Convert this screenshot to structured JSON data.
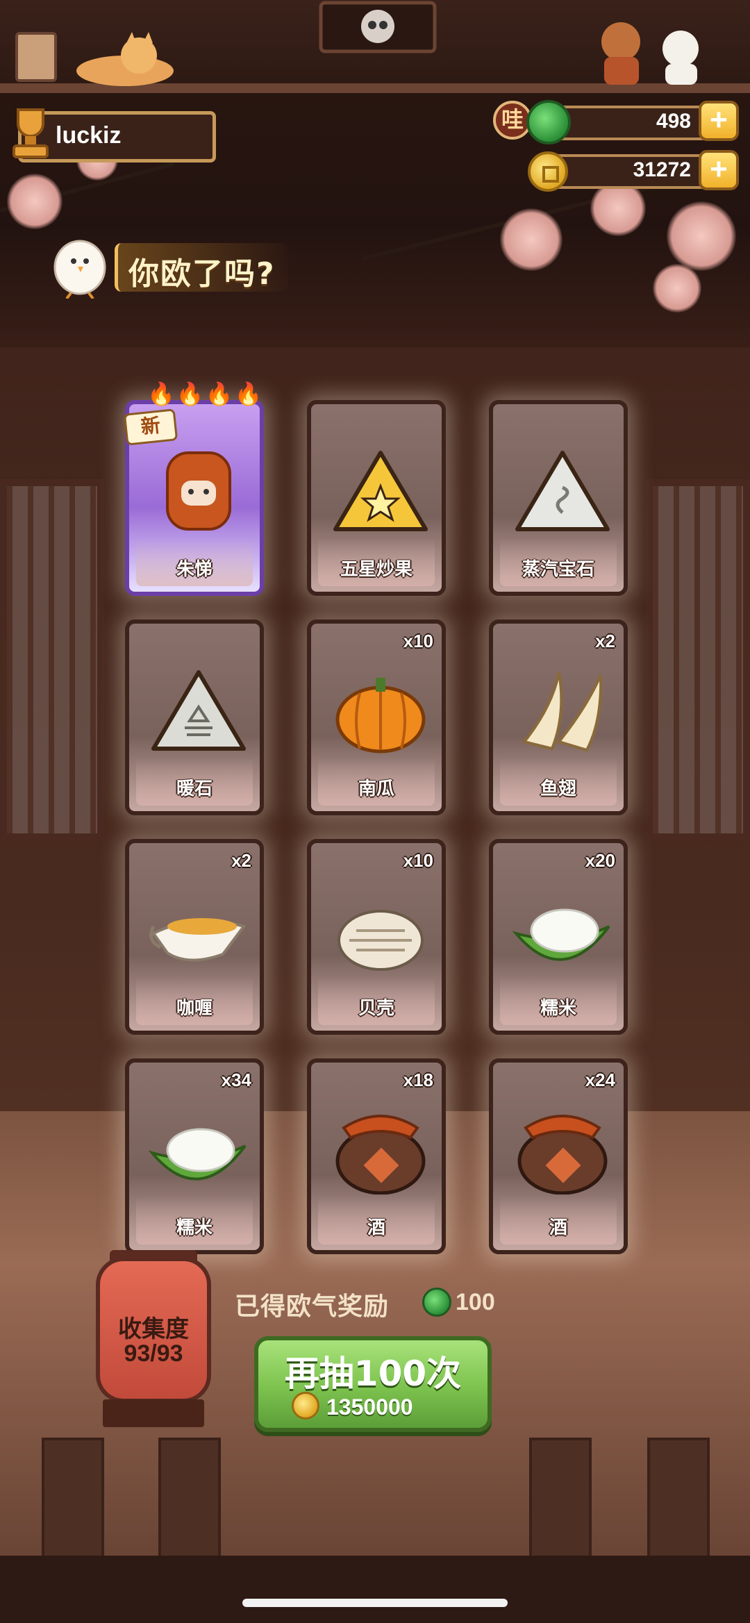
{
  "player": {
    "name": "luckiz"
  },
  "currency": {
    "gem_badge": "哇",
    "gems": "498",
    "coins": "31272",
    "plus": "+"
  },
  "speech": {
    "text": "你欧了吗?"
  },
  "cards": [
    {
      "label": "朱悌",
      "count": "",
      "icon": "wooden-robot-icon",
      "rarity_flames": "🔥🔥🔥🔥",
      "new_tag": "新",
      "legendary": true
    },
    {
      "label": "五星炒果",
      "count": "",
      "icon": "star-rice-ball-icon"
    },
    {
      "label": "蒸汽宝石",
      "count": "",
      "icon": "steam-stone-icon"
    },
    {
      "label": "暖石",
      "count": "",
      "icon": "warm-stone-icon"
    },
    {
      "label": "南瓜",
      "count": "x10",
      "icon": "pumpkin-icon"
    },
    {
      "label": "鱼翅",
      "count": "x2",
      "icon": "shark-fin-icon"
    },
    {
      "label": "咖喱",
      "count": "x2",
      "icon": "curry-gravy-boat-icon"
    },
    {
      "label": "贝壳",
      "count": "x10",
      "icon": "clam-shell-icon"
    },
    {
      "label": "糯米",
      "count": "x20",
      "icon": "glutinous-rice-leaf-icon"
    },
    {
      "label": "糯米",
      "count": "x34",
      "icon": "glutinous-rice-leaf-icon"
    },
    {
      "label": "酒",
      "count": "x18",
      "icon": "wine-jar-icon"
    },
    {
      "label": "酒",
      "count": "x24",
      "icon": "wine-jar-icon"
    }
  ],
  "collection": {
    "title": "收集度",
    "value": "93/93"
  },
  "reward": {
    "text": "已得欧气奖励",
    "value": "100"
  },
  "draw_button": {
    "label": "再抽100次",
    "cost": "1350000"
  },
  "colors": {
    "legend_card": "#9a6bd6",
    "normal_card": "#7a625c",
    "draw_button": "#7cc24e"
  }
}
